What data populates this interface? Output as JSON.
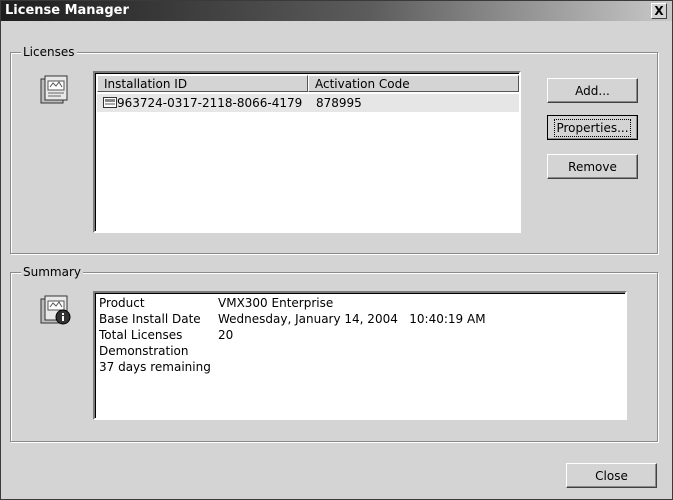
{
  "window": {
    "title": "License Manager",
    "close_glyph": "X"
  },
  "licenses": {
    "label": "Licenses",
    "icon": "license-document-icon",
    "columns": [
      "Installation ID",
      "Activation Code"
    ],
    "rows": [
      {
        "installation_id": "963724-0317-2118-8066-4179",
        "activation_code": "878995",
        "icon": "license-row-icon"
      }
    ],
    "buttons": {
      "add": "Add...",
      "properties": "Properties...",
      "remove": "Remove"
    }
  },
  "summary": {
    "label": "Summary",
    "icon": "license-info-icon",
    "fields": [
      {
        "label": "Product",
        "value": "VMX300 Enterprise"
      },
      {
        "label": "Base Install Date",
        "value": "Wednesday, January 14, 2004   10:40:19 AM"
      },
      {
        "label": "Total Licenses",
        "value": "20"
      }
    ],
    "notes": [
      "Demonstration",
      "37 days remaining"
    ]
  },
  "footer": {
    "close": "Close"
  }
}
